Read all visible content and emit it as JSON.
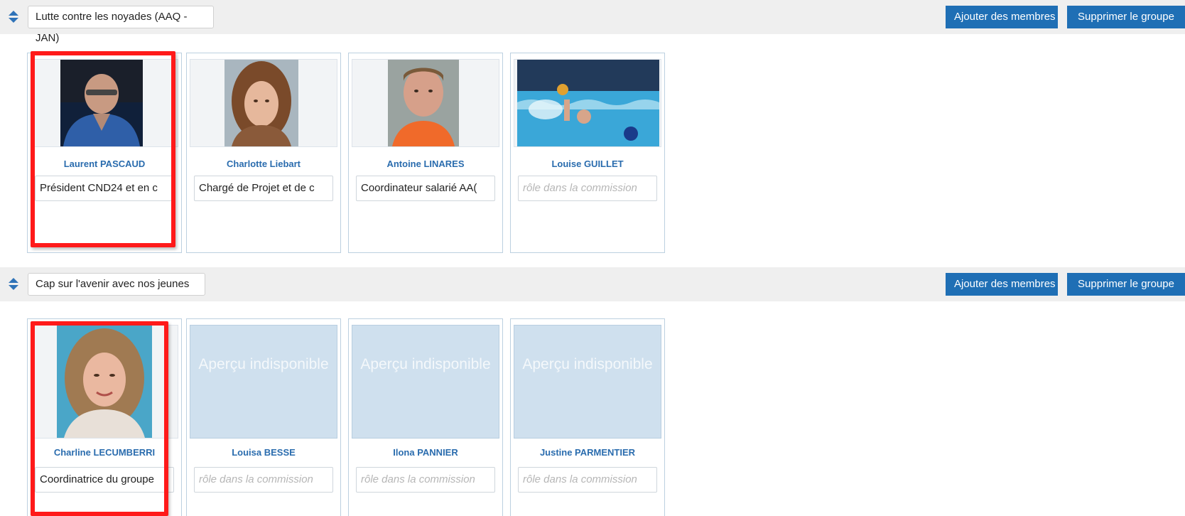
{
  "groups": [
    {
      "name": "Lutte contre les noyades (AAQ -JAN)",
      "add_members_label": "Ajouter des membres",
      "delete_group_label": "Supprimer le groupe",
      "members": [
        {
          "name": "Laurent PASCAUD",
          "role": "Président CND24 et en c",
          "role_placeholder": "rôle dans la commission",
          "photo": "man-photo"
        },
        {
          "name": "Charlotte Liebart",
          "role": "Chargé de Projet et de c",
          "role_placeholder": "rôle dans la commission",
          "photo": "woman-photo"
        },
        {
          "name": "Antoine LINARES",
          "role": "Coordinateur salarié AA(",
          "role_placeholder": "rôle dans la commission",
          "photo": "man-photo"
        },
        {
          "name": "Louise GUILLET",
          "role": "",
          "role_placeholder": "rôle dans la commission",
          "photo": "water-polo-photo"
        }
      ]
    },
    {
      "name": "Cap sur l'avenir avec nos jeunes",
      "add_members_label": "Ajouter des membres",
      "delete_group_label": "Supprimer le groupe",
      "members": [
        {
          "name": "Charline LECUMBERRI",
          "role": "Coordinatrice du groupe",
          "role_placeholder": "rôle dans la commission",
          "photo": "woman-photo"
        },
        {
          "name": "Louisa BESSE",
          "role": "",
          "role_placeholder": "rôle dans la commission",
          "photo": "unavailable"
        },
        {
          "name": "Ilona PANNIER",
          "role": "",
          "role_placeholder": "rôle dans la commission",
          "photo": "unavailable"
        },
        {
          "name": "Justine PARMENTIER",
          "role": "",
          "role_placeholder": "rôle dans la commission",
          "photo": "unavailable"
        }
      ]
    }
  ],
  "unavailable_preview_text": "Aperçu indisponible",
  "colors": {
    "button_blue": "#1f6fb5",
    "name_blue": "#2a6cae",
    "highlight_red": "#ff1a1a",
    "header_bg": "#efefef"
  }
}
